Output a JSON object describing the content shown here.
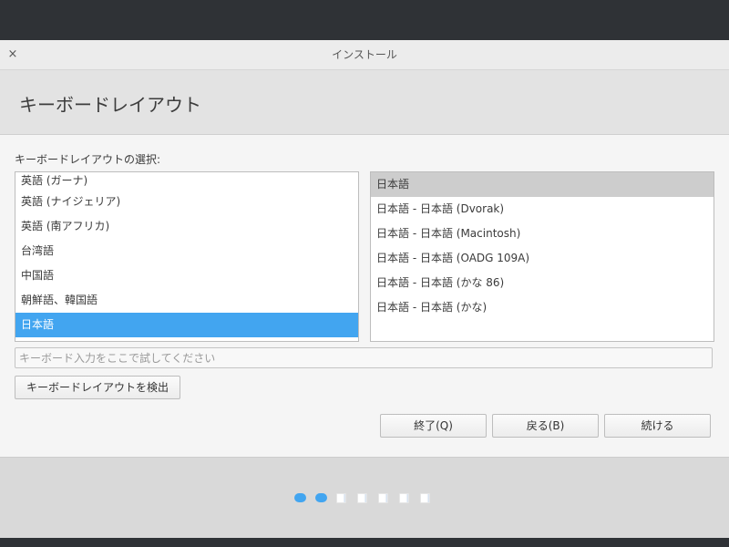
{
  "window": {
    "title": "インストール",
    "close_icon": "×"
  },
  "header": {
    "title": "キーボードレイアウト"
  },
  "section_label": "キーボードレイアウトの選択:",
  "languages": {
    "items": [
      {
        "label": "英語 (ガーナ)"
      },
      {
        "label": "英語 (ナイジェリア)"
      },
      {
        "label": "英語 (南アフリカ)"
      },
      {
        "label": "台湾語"
      },
      {
        "label": "中国語"
      },
      {
        "label": "朝鮮語、韓国語"
      },
      {
        "label": "日本語"
      }
    ],
    "selected": "日本語",
    "selected_color": "#42a5f0"
  },
  "layouts": {
    "items": [
      {
        "label": "日本語"
      },
      {
        "label": "日本語 - 日本語 (Dvorak)"
      },
      {
        "label": "日本語 - 日本語 (Macintosh)"
      },
      {
        "label": "日本語 - 日本語 (OADG 109A)"
      },
      {
        "label": "日本語 - 日本語 (かな 86)"
      },
      {
        "label": "日本語 - 日本語 (かな)"
      }
    ],
    "selected": "日本語"
  },
  "test_input": {
    "placeholder": "キーボード入力をここで試してください",
    "value": ""
  },
  "buttons": {
    "detect": "キーボードレイアウトを検出",
    "quit": "終了(Q)",
    "back": "戻る(B)",
    "continue": "続ける"
  },
  "progress": {
    "completed_steps": 2,
    "total_steps": 7
  }
}
